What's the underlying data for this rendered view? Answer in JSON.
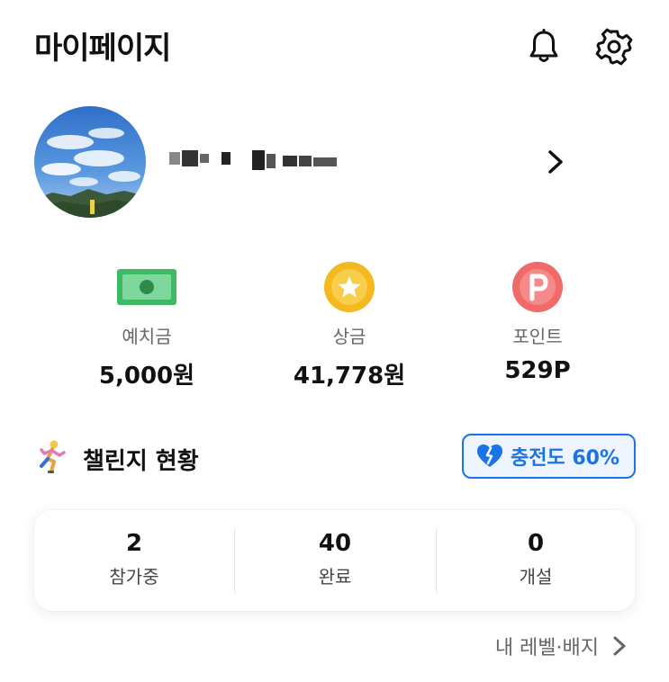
{
  "header": {
    "title": "마이페이지",
    "icons": [
      "bell-icon",
      "gear-icon"
    ]
  },
  "profile": {
    "name": "",
    "avatar": "sky-landscape-photo",
    "chevron_icon": "chevron-right-icon"
  },
  "balances": [
    {
      "icon": "cash-icon",
      "label": "예치금",
      "value": "5,000원"
    },
    {
      "icon": "star-coin-icon",
      "label": "상금",
      "value": "41,778원"
    },
    {
      "icon": "point-coin-icon",
      "label": "포인트",
      "value": "529P"
    }
  ],
  "challenge": {
    "icon": "runner-icon",
    "title": "챌린지 현황",
    "charge_label": "충전도 60%",
    "charge_percent": 60,
    "stats": [
      {
        "value": "2",
        "label": "참가중"
      },
      {
        "value": "40",
        "label": "완료"
      },
      {
        "value": "0",
        "label": "개설"
      }
    ]
  },
  "level_link": {
    "label": "내 레벨·배지"
  },
  "colors": {
    "accent": "#1a73e8",
    "cash_green": "#3dbb63",
    "coin_gold": "#f5b920",
    "point_red": "#f06a6a"
  }
}
